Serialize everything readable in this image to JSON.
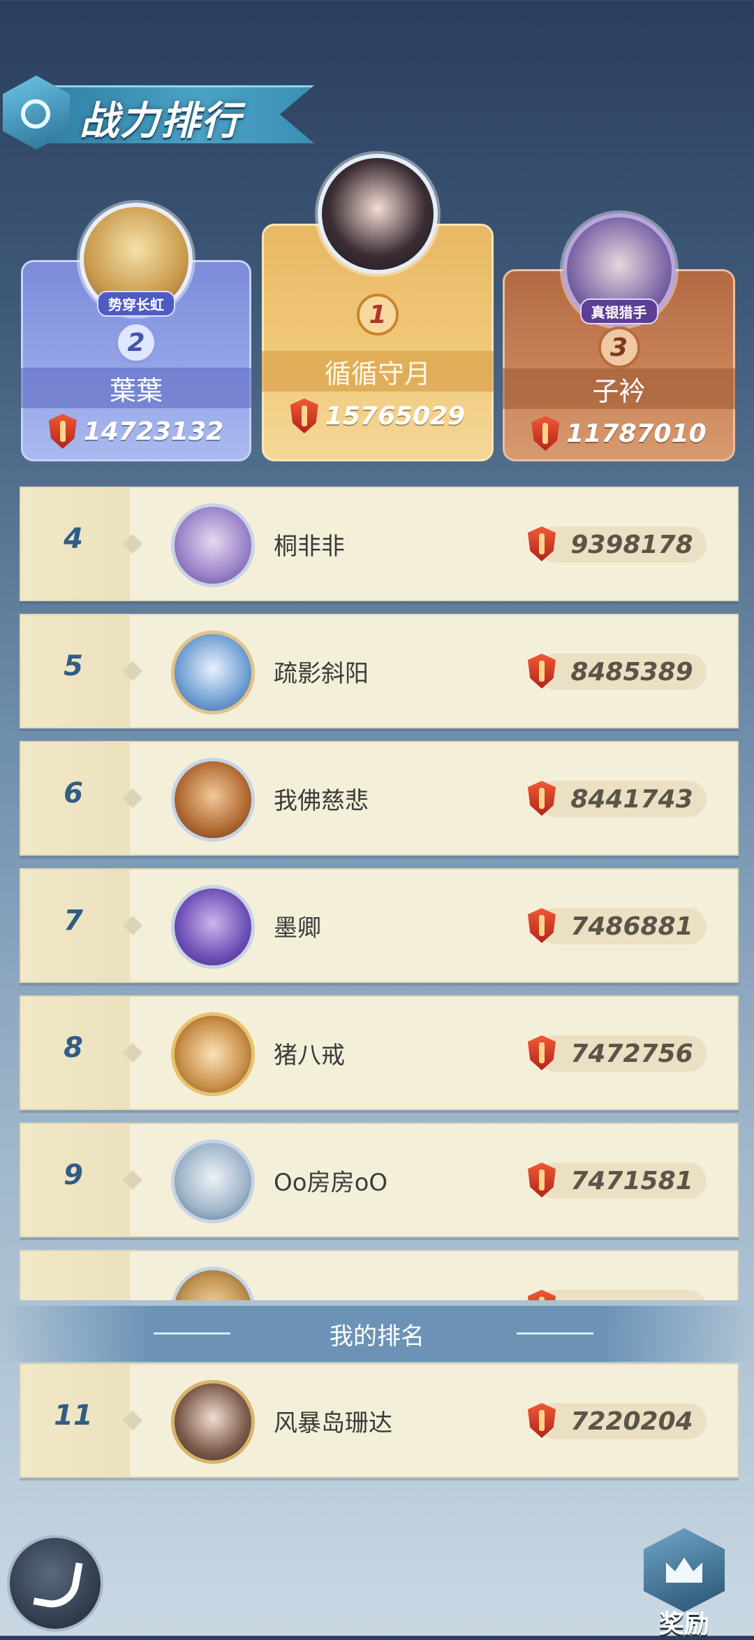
{
  "header": {
    "title": "战力排行"
  },
  "top3": [
    {
      "rank": "2",
      "name": "葉葉",
      "power": "14723132",
      "tag": "势穿长虹"
    },
    {
      "rank": "1",
      "name": "循循守月",
      "power": "15765029"
    },
    {
      "rank": "3",
      "name": "子衿",
      "power": "11787010",
      "tag": "真银猎手"
    }
  ],
  "list": [
    {
      "rank": "4",
      "name": "桐非非",
      "power": "9398178"
    },
    {
      "rank": "5",
      "name": "疏影斜阳",
      "power": "8485389"
    },
    {
      "rank": "6",
      "name": "我佛慈悲",
      "power": "8441743"
    },
    {
      "rank": "7",
      "name": "墨卿",
      "power": "7486881"
    },
    {
      "rank": "8",
      "name": "猪八戒",
      "power": "7472756"
    },
    {
      "rank": "9",
      "name": "Oo房房oO",
      "power": "7471581"
    }
  ],
  "my_rank_label": "我的排名",
  "my_rank": {
    "rank": "11",
    "name": "风暴岛珊达",
    "power": "7220204"
  },
  "buttons": {
    "reward_label": "奖励"
  },
  "colors": {
    "rank_num": "#2f5d86",
    "gold": "#f1c97a",
    "silver": "#93a5e8",
    "bronze": "#c98358"
  }
}
